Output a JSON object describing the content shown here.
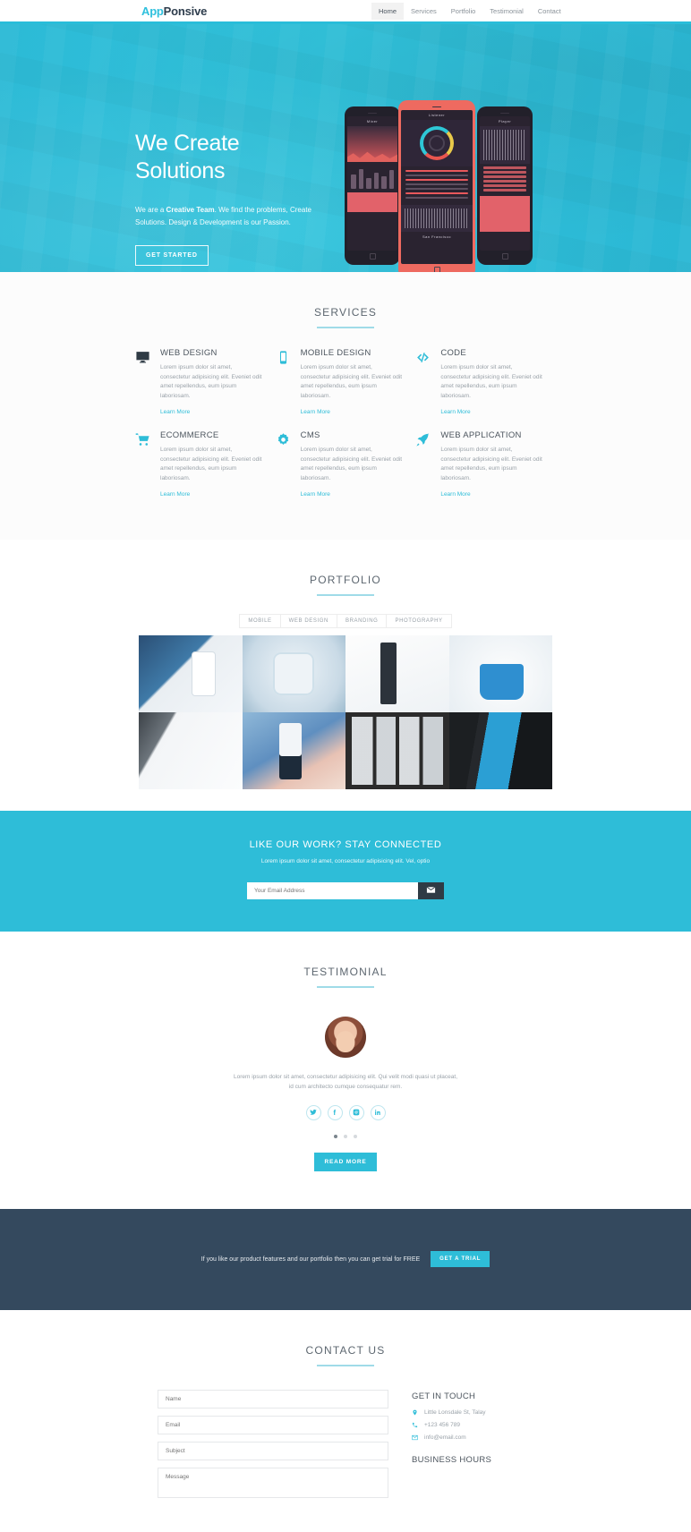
{
  "nav": {
    "logo_first": "App",
    "logo_second": "Ponsive",
    "links": [
      {
        "label": "Home",
        "active": true
      },
      {
        "label": "Services",
        "active": false
      },
      {
        "label": "Portfolio",
        "active": false
      },
      {
        "label": "Testimonial",
        "active": false
      },
      {
        "label": "Contact",
        "active": false
      }
    ]
  },
  "hero": {
    "heading": "We Create\nSolutions",
    "sub_pre": "We are a ",
    "sub_strong": "Creative Team",
    "sub_post": ". We find the problems, Create Solutions. Design & Development is our Passion.",
    "button": "GET STARTED",
    "phone_screens": {
      "left_title": "Mixer",
      "center_title": "Listener",
      "right_title": "Player",
      "center_caption": "San Francisco"
    }
  },
  "services": {
    "title": "SERVICES",
    "items": [
      {
        "icon": "desktop-icon",
        "title": "WEB DESIGN",
        "body": "Lorem ipsum dolor sit amet, consectetur adipisicing elit. Eveniet odit amet repellendus, eum ipsum laboriosam.",
        "link": "Learn More"
      },
      {
        "icon": "mobile-icon",
        "title": "MOBILE DESIGN",
        "body": "Lorem ipsum dolor sit amet, consectetur adipisicing elit. Eveniet odit amet repellendus, eum ipsum laboriosam.",
        "link": "Learn More"
      },
      {
        "icon": "code-icon",
        "title": "CODE",
        "body": "Lorem ipsum dolor sit amet, consectetur adipisicing elit. Eveniet odit amet repellendus, eum ipsum laboriosam.",
        "link": "Learn More"
      },
      {
        "icon": "cart-icon",
        "title": "ECOMMERCE",
        "body": "Lorem ipsum dolor sit amet, consectetur adipisicing elit. Eveniet odit amet repellendus, eum ipsum laboriosam.",
        "link": "Learn More"
      },
      {
        "icon": "gear-icon",
        "title": "CMS",
        "body": "Lorem ipsum dolor sit amet, consectetur adipisicing elit. Eveniet odit amet repellendus, eum ipsum laboriosam.",
        "link": "Learn More"
      },
      {
        "icon": "rocket-icon",
        "title": "WEB APPLICATION",
        "body": "Lorem ipsum dolor sit amet, consectetur adipisicing elit. Eveniet odit amet repellendus, eum ipsum laboriosam.",
        "link": "Learn More"
      }
    ]
  },
  "portfolio": {
    "title": "PORTFOLIO",
    "filters": [
      "MOBILE",
      "WEB DESIGN",
      "BRANDING",
      "PHOTOGRAPHY"
    ],
    "items": [
      {
        "name": "close-app-website"
      },
      {
        "name": "medical-app-icon"
      },
      {
        "name": "dashboard-ui-kit"
      },
      {
        "name": "toolbox-illustration"
      },
      {
        "name": "tablet-dashboard"
      },
      {
        "name": "phone-in-hand-speedometer"
      },
      {
        "name": "photo-grid-layout"
      },
      {
        "name": "tablet-blue-app"
      }
    ]
  },
  "newsletter": {
    "title": "LIKE OUR WORK? STAY CONNECTED",
    "subtitle": "Lorem ipsum dolor sit amet, consectetur adipisicing elit. Vel, optio",
    "placeholder": "Your Email Address",
    "submit_icon": "envelope-icon"
  },
  "testimonial": {
    "title": "TESTIMONIAL",
    "quote": "Lorem ipsum dolor sit amet, consectetur adipisicing elit. Qui velit modi quasi ut placeat, id cum architecto cumque consequatur rem.",
    "socials": [
      "twitter-icon",
      "facebook-icon",
      "instagram-icon",
      "linkedin-icon"
    ],
    "dots": [
      true,
      false,
      false
    ],
    "button": "READ MORE"
  },
  "trial": {
    "text": "If you like our product features and our portfolio then you can get trial for FREE",
    "button": "GET A TRIAL"
  },
  "contact": {
    "title": "CONTACT US",
    "form": {
      "name_placeholder": "Name",
      "email_placeholder": "Email",
      "subject_placeholder": "Subject",
      "message_placeholder": "Message"
    },
    "get_in_touch_title": "GET IN TOUCH",
    "details": [
      {
        "icon": "map-pin-icon",
        "value": "Little Lonsdale St, Talay"
      },
      {
        "icon": "phone-icon",
        "value": "+123 456 789"
      },
      {
        "icon": "envelope-icon",
        "value": "info@email.com"
      }
    ],
    "business_hours_title": "BUSINESS HOURS"
  },
  "colors": {
    "accent": "#2ebdd8",
    "dark": "#34495e",
    "muted": "#9aa2a9"
  }
}
